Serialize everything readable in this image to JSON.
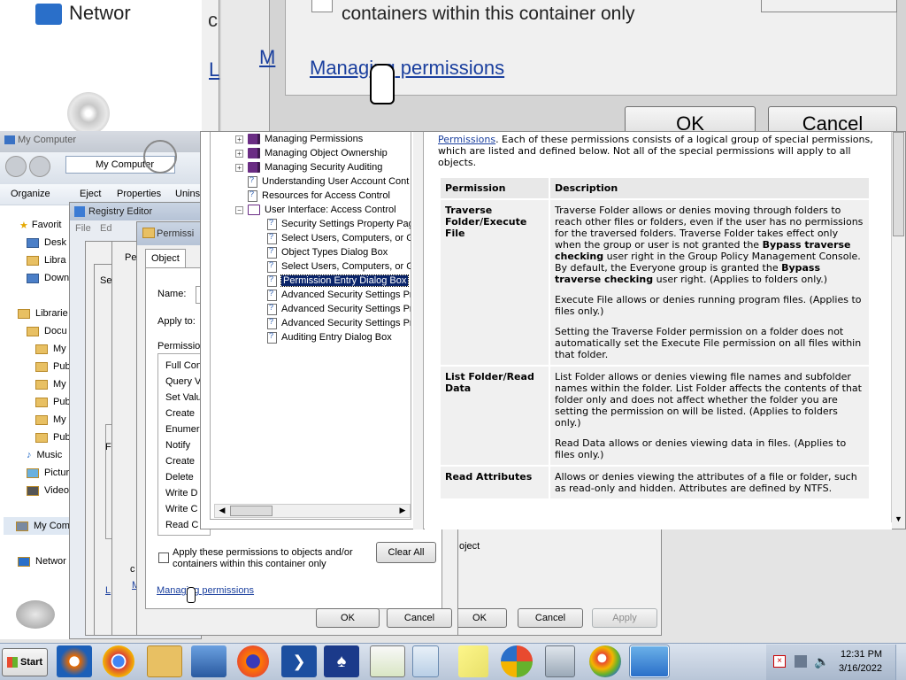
{
  "bg_zoom": {
    "network_label": "Networ",
    "checkbox_text": "containers within this container only",
    "manage_link": "Managing permissions",
    "ok_label": "OK",
    "cancel_label": "Cancel",
    "c_text": "c",
    "l_text": "L",
    "m_text": "M"
  },
  "explorer": {
    "title": "My Computer",
    "address": "My Computer",
    "toolbar": [
      "Organize",
      "Eject",
      "Properties",
      "Unins"
    ],
    "nav_items": [
      "Favorit",
      "Desk",
      "Libra",
      "Down",
      "Librarie",
      "Docu",
      "My",
      "Pub",
      "My",
      "Pub",
      "My",
      "Pub",
      "Music",
      "Pictur",
      "Video",
      "My Com",
      "Networ"
    ]
  },
  "registry": {
    "title": "Registry Editor",
    "menu": [
      "File",
      "Ed"
    ]
  },
  "perm_entry": {
    "title": "Permissi",
    "tab_object": "Object",
    "name_label": "Name:",
    "apply_label": "Apply to:",
    "permissions_label": "Permission",
    "perm_items": [
      "Full Con",
      "Query V",
      "Set Valu",
      "Create",
      "Enumer",
      "Notify",
      "Create",
      "Delete",
      "Write D",
      "Write C",
      "Read C"
    ],
    "checkbox_label": "Apply these permissions to objects and/or containers within this container only",
    "clear_all": "Clear All",
    "manage_link": "Managing permissions",
    "ok": "OK",
    "cancel": "Cancel",
    "behind": {
      "pe_tab": "Pe",
      "se_text": "Se",
      "object_text": "oject",
      "ok": "OK",
      "cancel": "Cancel",
      "apply": "Apply",
      "l_text": "L",
      "m_text": "M",
      "c_text": "c",
      "r_text": "F"
    }
  },
  "help_tree": [
    {
      "label": "Managing Permissions",
      "kind": "book",
      "expander": "+"
    },
    {
      "label": "Managing Object Ownership",
      "kind": "book",
      "expander": "+"
    },
    {
      "label": "Managing Security Auditing",
      "kind": "book",
      "expander": "+"
    },
    {
      "label": "Understanding User Account Cont",
      "kind": "page"
    },
    {
      "label": "Resources for Access Control",
      "kind": "page"
    },
    {
      "label": "User Interface: Access Control",
      "kind": "book-open",
      "expander": "−"
    },
    {
      "label": "Security Settings Property Pag",
      "kind": "page",
      "child": true
    },
    {
      "label": "Select Users, Computers, or Gr",
      "kind": "page",
      "child": true
    },
    {
      "label": "Object Types Dialog Box",
      "kind": "page",
      "child": true
    },
    {
      "label": "Select Users, Computers, or Gr",
      "kind": "page",
      "child": true
    },
    {
      "label": "Permission Entry Dialog Box",
      "kind": "page",
      "child": true,
      "selected": true
    },
    {
      "label": "Advanced Security Settings Pr",
      "kind": "page",
      "child": true
    },
    {
      "label": "Advanced Security Settings Pr",
      "kind": "page",
      "child": true
    },
    {
      "label": "Advanced Security Settings Pr",
      "kind": "page",
      "child": true
    },
    {
      "label": "Auditing Entry Dialog Box",
      "kind": "page",
      "child": true
    }
  ],
  "help_content": {
    "intro_link": "Permissions",
    "intro_text": ". Each of these permissions consists of a logical group of special permissions, which are listed and defined below. Not all of the special permissions will apply to all objects.",
    "col_permission": "Permission",
    "col_description": "Description",
    "row1": {
      "term": "Traverse Folder/Execute File",
      "p1_a": "Traverse Folder allows or denies moving through folders to reach other files or folders, even if the user has no permissions for the traversed folders. Traverse Folder takes effect only when the group or user is not granted the ",
      "p1_b": "Bypass traverse checking",
      "p1_c": " user right in the Group Policy Management Console. By default, the Everyone group is granted the ",
      "p1_d": "Bypass traverse checking",
      "p1_e": " user right. (Applies to folders only.)",
      "p2": "Execute File allows or denies running program files. (Applies to files only.)",
      "p3": "Setting the Traverse Folder permission on a folder does not automatically set the Execute File permission on all files within that folder."
    },
    "row2": {
      "term": "List Folder/Read Data",
      "p1": "List Folder allows or denies viewing file names and subfolder names within the folder. List Folder affects the contents of that folder only and does not affect whether the folder you are setting the permission on will be listed. (Applies to folders only.)",
      "p2": "Read Data allows or denies viewing data in files. (Applies to files only.)"
    },
    "row3": {
      "term": "Read Attributes",
      "p1": "Allows or denies viewing the attributes of a file or folder, such as read-only and hidden. Attributes are defined by NTFS."
    }
  },
  "taskbar": {
    "start": "Start",
    "time": "12:31 PM",
    "date": "3/16/2022"
  }
}
